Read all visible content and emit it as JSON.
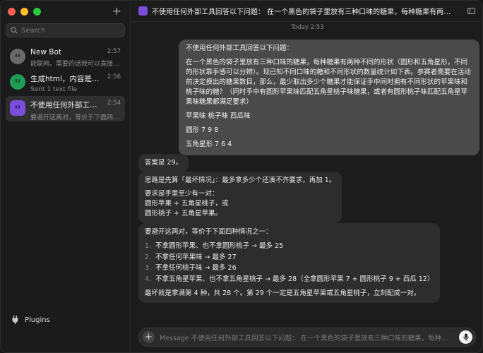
{
  "sidebar": {
    "search_placeholder": "Search",
    "conversations": [
      {
        "title": "New Bot",
        "time": "2:57",
        "subtitle": "能联网。需要的话我可以直接搜..."
      },
      {
        "title": "生成html，内容是svg绘...",
        "time": "2:56",
        "subtitle": "Sent 1 text file"
      },
      {
        "title": "不使用任何外部工具回...",
        "time": "2:54",
        "subtitle": "要避开这两对，等价于下面四种..."
      }
    ],
    "plugins_label": "Plugins"
  },
  "header": {
    "title": "不使用任何外部工具回答以下问题：  在一个黑色的袋子里放有三种口味的糖果，每种糖果有两种不同的形状（圆形..."
  },
  "chat": {
    "day_stamp": "Today 2:53",
    "user_message": {
      "p1": "不使用任何外部工具回答以下问题：",
      "p2": "在一个黑色的袋子里放有三种口味的糖果，每种糖果有两种不同的形状（圆形和五角星形，不同的形状靠手感可以分辨）。现已知不同口味的糖和不同形状的数量统计如下表。参赛者需要在活动前决定摸出的糖果数目，那么，最少取出多少个糖果才能保证手中同时拥有不同形状的苹果味和桃子味的糖？（同时手中有圆形苹果味匹配五角星桃子味糖果，或者有圆形桃子味匹配五角星苹果味糖果都满足要求）",
      "p3": "苹果味 桃子味 西瓜味",
      "p4": "圆形 7 9 8",
      "p5": "五角星形 7 6 4"
    },
    "bot_answer": "答案是 29。",
    "bot_reason": {
      "p1": "思路是先算「最坏情况」：最多拿多少个还凑不齐要求，再加 1。",
      "p2a": "要求是手里至少有一对：",
      "p2b": "圆形苹果 + 五角星桃子，或",
      "p2c": "圆形桃子 + 五角星苹果。"
    },
    "bot_cases": {
      "intro": "要避开这两对，等价于下面四种情况之一：",
      "items": [
        {
          "n": "1.",
          "text": "不拿圆形苹果、也不拿圆形桃子 → 最多 25"
        },
        {
          "n": "2.",
          "text": "不拿任何苹果味 → 最多 27"
        },
        {
          "n": "3.",
          "text": "不拿任何桃子味 → 最多 26"
        },
        {
          "n": "4.",
          "text": "不拿五角星苹果、也不拿五角星桃子 → 最多 28（全拿圆形苹果 7 + 圆形桃子 9 + 西瓜 12）"
        }
      ],
      "conclusion": "最坏就是拿满第 4 种，共 28 个。第 29 个一定是五角星苹果或五角星桃子，立刻配成一对。"
    }
  },
  "composer": {
    "placeholder": "Message 不使用任何外部工具回答以下问题：  在一个黑色的袋子里放有三种口味的糖果，每种糖果有..."
  },
  "colors": {
    "accent_purple": "#7c4ddb",
    "avatar_green": "#1f9d55",
    "avatar_grey": "#6a6a6a",
    "user_bubble": "#4a4a4a",
    "bot_bubble": "#2d2d2d"
  }
}
